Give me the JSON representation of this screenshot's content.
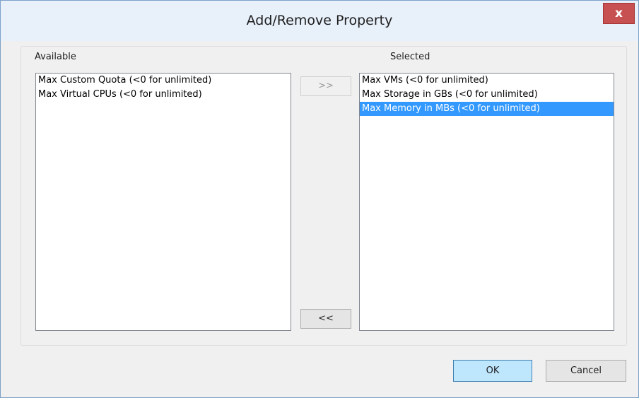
{
  "window": {
    "title": "Add/Remove Property",
    "close_label": "x"
  },
  "available": {
    "label": "Available",
    "items": [
      "Max Custom Quota (<0 for unlimited)",
      "Max Virtual CPUs (<0 for unlimited)"
    ]
  },
  "selected": {
    "label": "Selected",
    "items": [
      "Max VMs (<0 for unlimited)",
      "Max Storage in GBs (<0 for unlimited)",
      "Max Memory in MBs (<0 for unlimited)"
    ],
    "selected_index": 2
  },
  "buttons": {
    "add": ">>",
    "remove": "<<",
    "ok": "OK",
    "cancel": "Cancel"
  },
  "colors": {
    "selection": "#3399ff",
    "close_button": "#c75050",
    "ok_button": "#bee6fd"
  }
}
